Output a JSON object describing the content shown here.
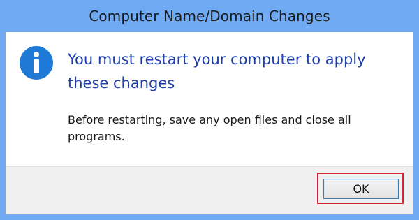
{
  "window": {
    "title": "Computer Name/Domain Changes"
  },
  "message": {
    "icon": "info-icon",
    "main_instruction": "You must restart your computer to apply these changes",
    "body": "Before restarting, save any open files and close all programs."
  },
  "buttons": {
    "ok_label": "OK"
  },
  "colors": {
    "titlebar": "#6faaf2",
    "instruction_text": "#1f3fa8",
    "icon_blue": "#1e7ad6",
    "highlight": "#d6263a"
  }
}
